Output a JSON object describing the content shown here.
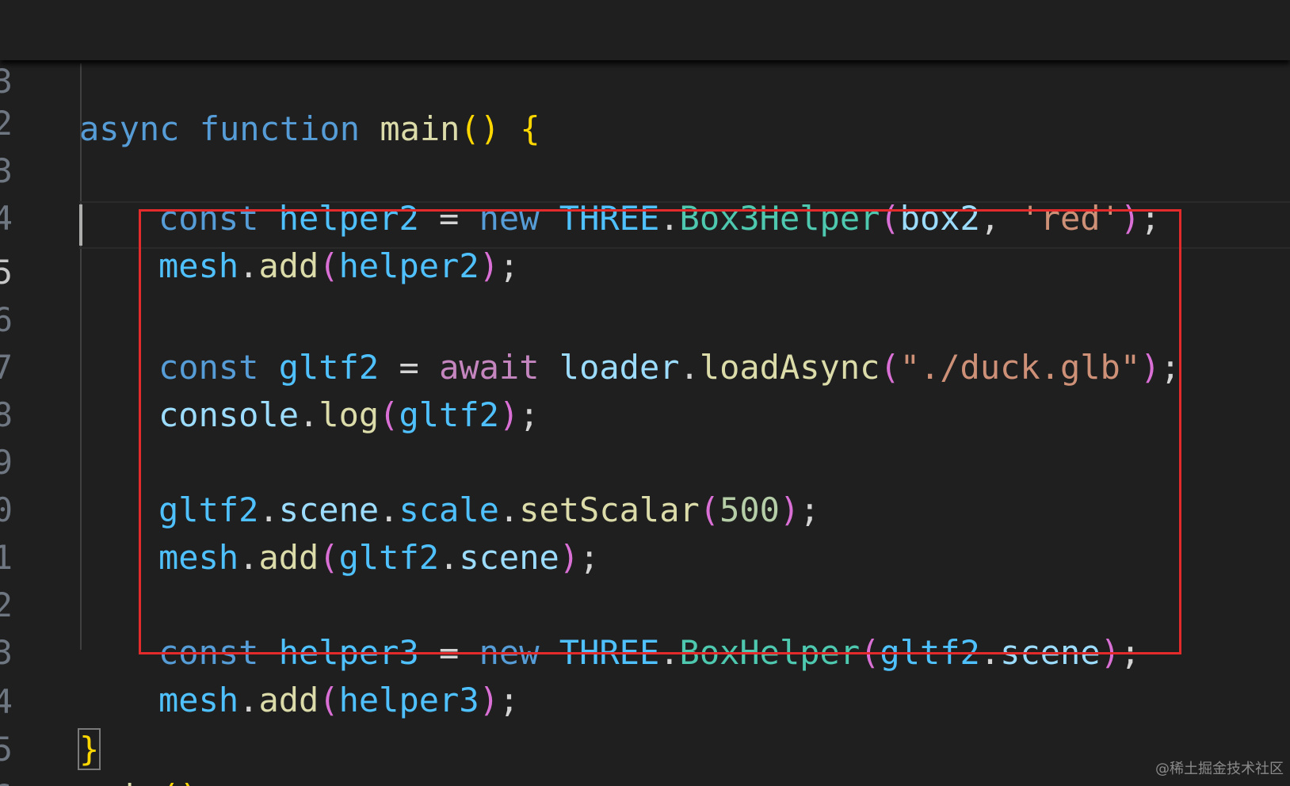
{
  "editor": {
    "theme_colors": {
      "background": "#1f1f1f",
      "keyword": "#569cd6",
      "control_keyword": "#c586c0",
      "variable": "#4fc1ff",
      "property": "#9cdcfe",
      "function": "#dcdcaa",
      "class": "#4ec9b0",
      "string": "#ce9178",
      "number": "#b5cea8",
      "highlight_box": "#e32b2b"
    },
    "sticky": {
      "line_number": "3",
      "tokens": [
        "async",
        "function",
        "main",
        "()",
        "{"
      ]
    },
    "lines": [
      {
        "line_number": "2",
        "text": ""
      },
      {
        "line_number": "3",
        "text": "const helper2 = new THREE.Box3Helper(box2, 'red');"
      },
      {
        "line_number": "4",
        "text": "mesh.add(helper2);"
      },
      {
        "line_number": "5",
        "text": "",
        "active": true
      },
      {
        "line_number": "6",
        "text": "const gltf2 = await loader.loadAsync(\"./duck.glb\");"
      },
      {
        "line_number": "7",
        "text": "console.log(gltf2);"
      },
      {
        "line_number": "8",
        "text": ""
      },
      {
        "line_number": "9",
        "text": "gltf2.scene.scale.setScalar(500);"
      },
      {
        "line_number": "0",
        "text": "mesh.add(gltf2.scene);"
      },
      {
        "line_number": "1",
        "text": ""
      },
      {
        "line_number": "2",
        "text": "const helper3 = new THREE.BoxHelper(gltf2.scene);"
      },
      {
        "line_number": "3",
        "text": "mesh.add(helper3);"
      },
      {
        "line_number": "4",
        "text": "}"
      },
      {
        "line_number": "5",
        "text": "main();"
      },
      {
        "line_number": "6",
        "text": ""
      }
    ]
  },
  "tokens": {
    "async": "async",
    "function": "function",
    "main": "main",
    "const": "const",
    "new": "new",
    "await": "await",
    "helper2": "helper2",
    "helper3": "helper3",
    "THREE": "THREE",
    "Box3Helper": "Box3Helper",
    "BoxHelper": "BoxHelper",
    "box2": "box2",
    "red": "'red'",
    "mesh": "mesh",
    "add": "add",
    "gltf2": "gltf2",
    "loader": "loader",
    "loadAsync": "loadAsync",
    "duck": "\"./duck.glb\"",
    "console": "console",
    "log": "log",
    "scene": "scene",
    "scale": "scale",
    "setScalar": "setScalar",
    "n500": "500"
  },
  "watermark": "@稀土掘金技术社区"
}
